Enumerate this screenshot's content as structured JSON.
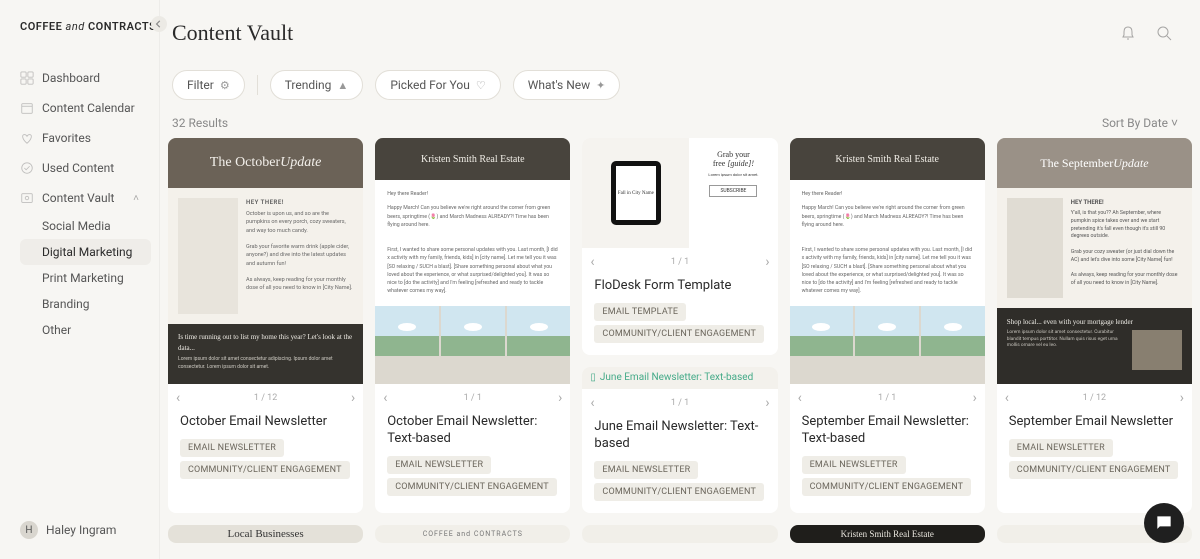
{
  "brand": {
    "part1": "COFFEE",
    "and": "and",
    "part2": "CONTRACTS"
  },
  "nav": [
    {
      "label": "Dashboard",
      "icon": "dashboard"
    },
    {
      "label": "Content Calendar",
      "icon": "calendar"
    },
    {
      "label": "Favorites",
      "icon": "heart"
    },
    {
      "label": "Used Content",
      "icon": "check"
    },
    {
      "label": "Content Vault",
      "icon": "vault",
      "expanded": true,
      "children": [
        {
          "label": "Social Media"
        },
        {
          "label": "Digital Marketing",
          "active": true
        },
        {
          "label": "Print Marketing"
        },
        {
          "label": "Branding"
        },
        {
          "label": "Other"
        }
      ]
    }
  ],
  "user": {
    "initial": "H",
    "name": "Haley Ingram"
  },
  "page_title": "Content Vault",
  "filters": {
    "filter": "Filter",
    "trending": "Trending",
    "picked": "Picked For You",
    "whatsnew": "What's New"
  },
  "results_count": "32 Results",
  "sort_label": "Sort By Date",
  "cards": [
    {
      "title": "October Email Newsletter",
      "page": "1 / 12",
      "tags": [
        "EMAIL NEWSLETTER",
        "COMMUNITY/CLIENT ENGAGEMENT"
      ],
      "thumb": {
        "banner": "The October Update",
        "hey": "HEY THERE!",
        "p1": "October is upon us, and so are the pumpkins on every porch, cozy sweaters, and way too much candy.",
        "p2": "Grab your favorite warm drink (apple cider, anyone?) and dive into the latest updates and autumn fun!",
        "p3": "As always, keep reading for your monthly dose of all you need to know in [City Name].",
        "darkh": "Is time running out to list my home this year? Let's look at the data..."
      }
    },
    {
      "title": "October Email Newsletter: Text-based",
      "page": "1 / 1",
      "tags": [
        "EMAIL NEWSLETTER",
        "COMMUNITY/CLIENT ENGAGEMENT"
      ],
      "thumb": {
        "banner": "Kristen Smith Real Estate",
        "greet": "Hey there Reader!",
        "body1": "Happy March! Can you believe we're right around the corner from green beers, springtime (🌷) and March Madness ALREADY?! Time has been flying around here.",
        "body2": "First, I wanted to share some personal updates with you. Last month, [I did x activity with my family, friends, kids] in [city name]. Let me tell you it was [SO relaxing / SUCH a blast]. [Share something personal about what you loved about the experience, or what surprised/delighted you]. It was so nice to [do the activity] and I'm feeling [refreshed and ready to tackle whatever comes my way]."
      }
    },
    {
      "title": "FloDesk Form Template",
      "page": "1 / 1",
      "tags": [
        "EMAIL TEMPLATE",
        "COMMUNITY/CLIENT ENGAGEMENT"
      ],
      "thumb": {
        "tablet": "Fall in City Name",
        "grab": "Grab your free [guide]!",
        "cta": "SUBSCRIBE"
      },
      "nested": {
        "title": "June Email Newsletter: Text-based",
        "page": "1 / 1",
        "tags": [
          "EMAIL NEWSLETTER",
          "COMMUNITY/CLIENT ENGAGEMENT"
        ],
        "alt": "June Email Newsletter: Text-based"
      }
    },
    {
      "title": "September Email Newsletter: Text-based",
      "page": "1 / 1",
      "tags": [
        "EMAIL NEWSLETTER",
        "COMMUNITY/CLIENT ENGAGEMENT"
      ],
      "thumb": {
        "banner": "Kristen Smith Real Estate",
        "greet": "Hey there Reader!",
        "body1": "Happy March! Can you believe we're right around the corner from green beers, springtime (🌷) and March Madness ALREADY?! Time has been flying around here.",
        "body2": "First, I wanted to share some personal updates with you. Last month, [I did x activity with my family, friends, kids] in [city name]. Let me tell you it was [SO relaxing / SUCH a blast]. [Share something personal about what you loved about the experience, or what surprised/delighted you]. It was so nice to [do the activity] and I'm feeling [refreshed and ready to tackle whatever comes my way]."
      }
    },
    {
      "title": "September Email Newsletter",
      "page": "1 / 12",
      "tags": [
        "EMAIL NEWSLETTER",
        "COMMUNITY/CLIENT ENGAGEMENT"
      ],
      "thumb": {
        "banner": "The September Update",
        "hey": "HEY THERE!",
        "p1": "Y'all, is that you?? Ah September, where pumpkin spice takes over and we start pretending it's fall even though it's still 90 degrees outside.",
        "p2": "Grab your cozy sweater (or just dial down the AC) and let's dive into some [City Name] fun!",
        "p3": "As always, keep reading for your monthly dose of all you need to know in [City Name].",
        "darkh": "Shop local... even with your mortgage lender"
      }
    }
  ],
  "row2": [
    {
      "text": "Local Businesses",
      "style": "gr"
    },
    {
      "text": "COFFEE and CONTRACTS",
      "style": "lt"
    },
    {
      "text": "",
      "style": "lt"
    },
    {
      "text": "Kristen Smith Real Estate",
      "style": "dk"
    },
    {
      "text": "",
      "style": "lt"
    }
  ]
}
